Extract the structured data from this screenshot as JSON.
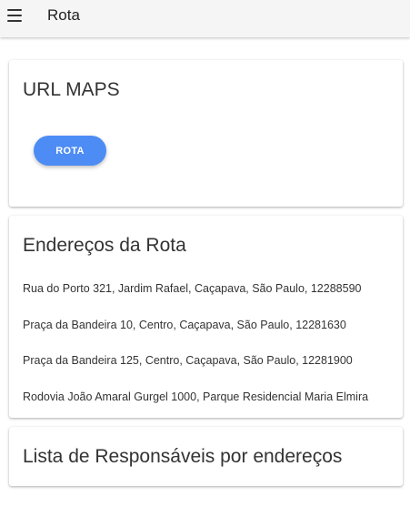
{
  "appbar": {
    "title": "Rota",
    "menu_icon": "hamburger-menu-icon"
  },
  "url_card": {
    "title": "URL MAPS",
    "button_label": "ROTA",
    "button_color": "#4d8cf5"
  },
  "enderecos_card": {
    "title": "Endereços da Rota",
    "items": [
      "Rua do Porto 321, Jardim Rafael, Caçapava, São Paulo, 12288590",
      "Praça da Bandeira 10, Centro, Caçapava, São Paulo, 12281630",
      "Praça da Bandeira 125, Centro, Caçapava, São Paulo, 12281900",
      "Rodovia João Amaral Gurgel 1000, Parque Residencial Maria Elmira"
    ]
  },
  "lista_card": {
    "title": "Lista de Responsáveis por endereços"
  }
}
